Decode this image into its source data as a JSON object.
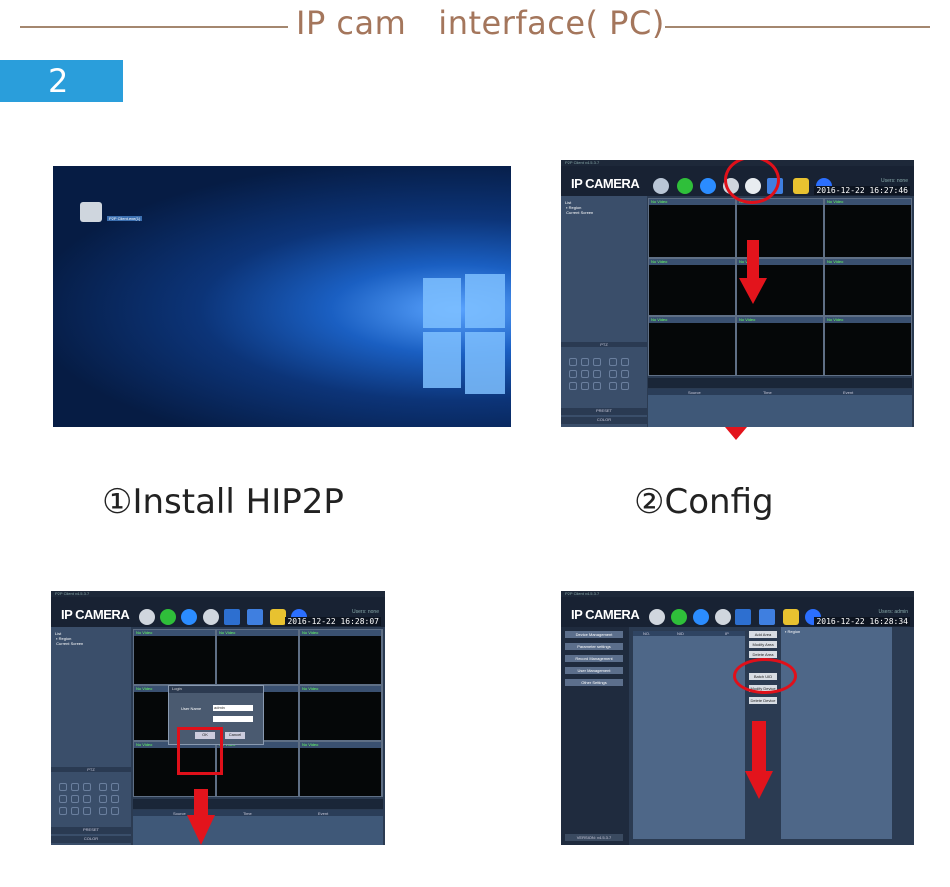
{
  "header": {
    "title": "IP cam   interface( PC)",
    "step_number": "2"
  },
  "captions": {
    "step1": "①Install HIP2P",
    "step2": "②Config"
  },
  "desktop": {
    "icon_label": "P2P Client.exe(1)"
  },
  "app": {
    "window_title": "P2P Client v4.5.3.7",
    "brand": "IP CAMERA",
    "users_label": "Users: none",
    "users_label_admin": "Users: admin",
    "tree_root": "List",
    "tree_region": "Region",
    "tree_current": "Current Screen",
    "ptz_label": "PTZ",
    "preset_label": "PRESET",
    "color_label": "COLOR",
    "cell_tag": "No Video",
    "log_columns": [
      "Source",
      "Time",
      "Event"
    ],
    "clock_config": "2016-12-22  16:27:46",
    "clock_login": "2016-12-22  16:28:07",
    "clock_settings": "2016-12-22  16:28:34"
  },
  "login_dialog": {
    "title": "Login",
    "user_label": "User Name",
    "user_value": "admin",
    "password_label": "Password",
    "ok_label": "OK",
    "cancel_label": "Cancel"
  },
  "settings": {
    "menu": [
      "Device Management",
      "Parameter settings",
      "Record Management",
      "User Management",
      "Other Settings"
    ],
    "table_columns": [
      "NO.",
      "NID",
      "IP"
    ],
    "buttons": [
      "Add Area",
      "Modify Area",
      "Delete Area",
      "",
      "Batch UID",
      "Modify Device",
      "Delete Device"
    ],
    "tree_region": "Region",
    "version": "VERSION: v4.5.3.7"
  },
  "colors": {
    "accent": "#2a9edb",
    "title": "#a4765c",
    "highlight": "#e0101a"
  }
}
